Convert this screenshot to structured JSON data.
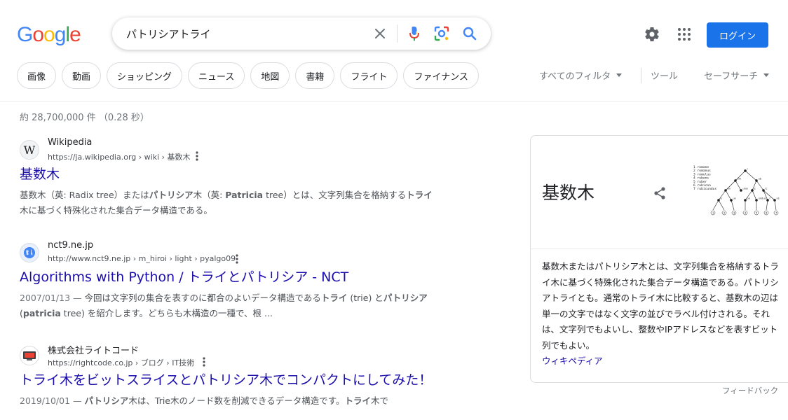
{
  "brand": {
    "logo_letters": [
      "G",
      "o",
      "o",
      "g",
      "l",
      "e"
    ],
    "logo_colors": [
      "#4285f4",
      "#ea4335",
      "#fbbc05",
      "#4285f4",
      "#34a853",
      "#ea4335"
    ]
  },
  "search": {
    "query": "パトリシアトライ",
    "icons": [
      "clear-icon",
      "microphone-icon",
      "lens-icon",
      "search-icon"
    ]
  },
  "header": {
    "login_label": "ログイン",
    "icons": [
      "settings-icon",
      "apps-grid-icon"
    ]
  },
  "chips": [
    "画像",
    "動画",
    "ショッピング",
    "ニュース",
    "地図",
    "書籍",
    "フライト",
    "ファイナンス"
  ],
  "tools": {
    "all_filters": "すべてのフィルタ",
    "tools": "ツール",
    "safe_search": "セーフサーチ"
  },
  "stats": "約 28,700,000 件 （0.28 秒）",
  "results": [
    {
      "site_name": "Wikipedia",
      "url": "https://ja.wikipedia.org › wiki › 基数木",
      "favicon": "W",
      "title": "基数木",
      "snippet_parts": [
        {
          "t": "基数木（英: Radix tree）または"
        },
        {
          "t": "パトリシア",
          "b": true
        },
        {
          "t": "木（英: "
        },
        {
          "t": "Patricia",
          "b": true
        },
        {
          "t": " tree）とは、文字列集合を格納する"
        },
        {
          "t": "トライ",
          "b": true
        },
        {
          "t": "木に基づく特殊化された集合データ構造である。"
        }
      ]
    },
    {
      "site_name": "nct9.ne.jp",
      "url": "http://www.nct9.ne.jp › m_hiroi › light › pyalgo09",
      "favicon": "globe",
      "title": "Algorithms with Python / トライとパトリシア - NCT",
      "date": "2007/01/13 — ",
      "snippet_parts": [
        {
          "t": "今回は文字列の集合を表すのに都合のよいデータ構造である"
        },
        {
          "t": "トライ",
          "b": true
        },
        {
          "t": " (trie) と"
        },
        {
          "t": "パトリシア",
          "b": true
        },
        {
          "t": " ("
        },
        {
          "t": "patricia",
          "b": true
        },
        {
          "t": " tree) を紹介します。どちらも木構造の一種で、根 ..."
        }
      ]
    },
    {
      "site_name": "株式会社ライトコード",
      "url": "https://rightcode.co.jp › ブログ › IT技術",
      "favicon": "rightcode",
      "title": "トライ木をビットスライスとパトリシア木でコンパクトにしてみた！",
      "date": "2019/10/01 — ",
      "snippet_parts": [
        {
          "t": "パトリシア",
          "b": true
        },
        {
          "t": "木は、Trie木のノード数を削減できるデータ構造です。"
        },
        {
          "t": "トライ",
          "b": true
        },
        {
          "t": "木で"
        }
      ]
    }
  ],
  "knowledge_panel": {
    "title": "基数木",
    "description": "基数木またはパトリシア木とは、文字列集合を格納するトライ木に基づく特殊化された集合データ構造である。パトリシアトライとも。通常のトライ木に比較すると、基数木の辺は単一の文字ではなく文字の並びでラベル付けされる。それは、文字列でもよいし、整数やIPアドレスなどを表すビット列でもよい。",
    "source_link": "ウィキペディア",
    "diagram_words": [
      "romane",
      "romanus",
      "romulus",
      "rubens",
      "ruber",
      "rubicon",
      "rubicundus"
    ],
    "diagram_nodes": [
      "r",
      "om",
      "ub",
      "an",
      "ulus",
      "e",
      "ic",
      "e",
      "us",
      "on",
      "undus",
      "r",
      "ns",
      "1",
      "2",
      "3",
      "4",
      "5",
      "6",
      "7"
    ]
  },
  "feedback": "フィードバック"
}
